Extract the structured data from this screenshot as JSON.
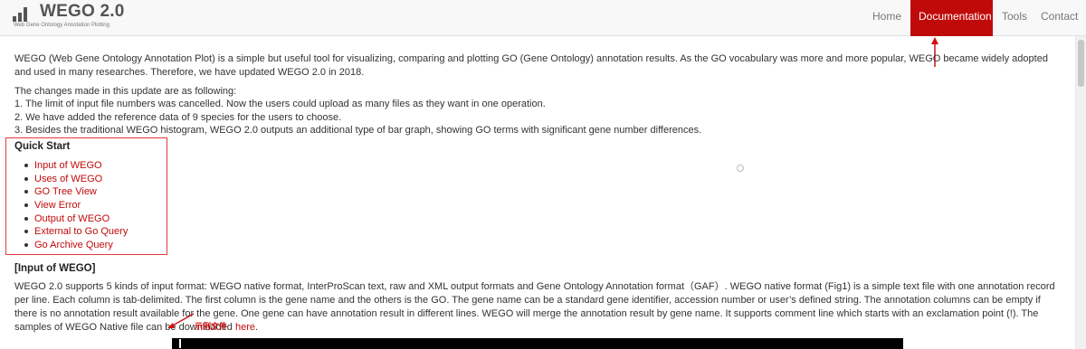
{
  "header": {
    "brand_title": "WEGO 2.0",
    "brand_subtitle": "Web Gene Ontology Annotation Plotting",
    "logo_icon": "bar-chart-icon",
    "nav": [
      {
        "label": "Home"
      },
      {
        "label": "Documentation"
      },
      {
        "label": "Tools"
      },
      {
        "label": "Contact"
      }
    ],
    "active_nav": "Documentation",
    "accent_color": "#c00a0a"
  },
  "intro": {
    "p1": "WEGO (Web Gene Ontology Annotation Plot) is a simple but useful tool for visualizing, comparing and plotting GO (Gene Ontology) annotation results. As the GO vocabulary was more and more popular, WEGO became widely adopted and used in many researches. Therefore, we have updated WEGO 2.0 in 2018.",
    "changes_intro": "The changes made in this update are as following:",
    "change_1": "1. The limit of input file numbers was cancelled. Now the users could upload as many files as they want in one operation.",
    "change_2": "2. We have added the reference data of 9 species for the users to choose.",
    "change_3": "3. Besides the traditional WEGO histogram, WEGO 2.0 outputs an additional type of bar graph, showing GO terms with significant gene number differences."
  },
  "quick_start": {
    "title": "Quick Start",
    "items": [
      {
        "label": "Input of WEGO"
      },
      {
        "label": "Uses of WEGO"
      },
      {
        "label": "GO Tree View"
      },
      {
        "label": "View Error"
      },
      {
        "label": "Output of WEGO"
      },
      {
        "label": "External to Go Query"
      },
      {
        "label": "Go Archive Query"
      }
    ]
  },
  "input_section": {
    "title": "[Input of WEGO]",
    "text": "WEGO 2.0 supports 5 kinds of input format: WEGO native format, InterProScan text, raw and XML output formats and Gene Ontology Annotation format（GAF）. WEGO native format (Fig1) is a simple text file with one annotation record per line. Each column is tab-delimited. The first column is the gene name and the others is the GO. The gene name can be a standard gene identifier, accession number or user’s defined string. The annotation columns can be empty if there is no annotation result available for the gene. One gene can have annotation result in different lines. WEGO will merge the annotation result by gene name. It supports comment line which starts with an exclamation point (!). The samples of WEGO Native file can be downloaded ",
    "link_text": "here",
    "trailing": "."
  },
  "annotation": {
    "label": "示例文件",
    "color": "#d01010"
  }
}
